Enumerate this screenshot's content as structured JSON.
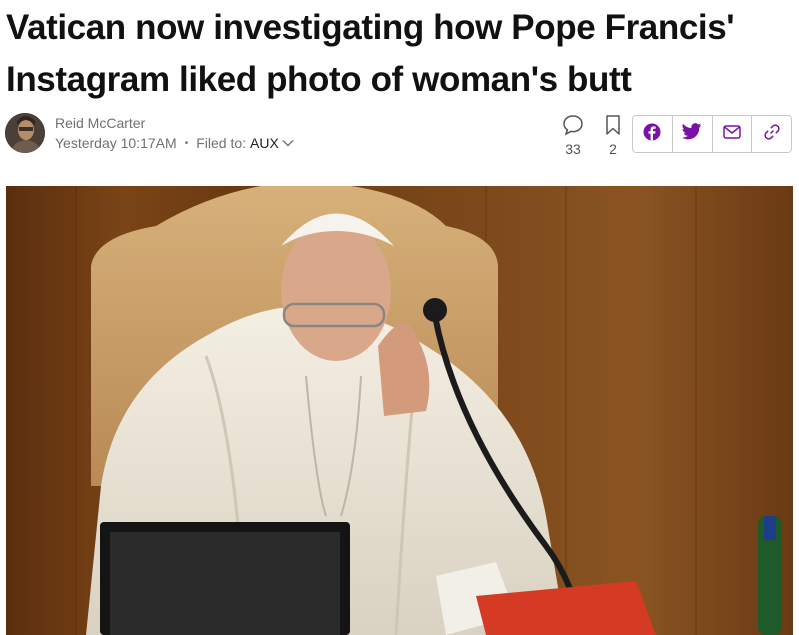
{
  "article": {
    "headline": "Vatican now investigating how Pope Francis' Instagram liked photo of woman's butt"
  },
  "byline": {
    "author": "Reid McCarter",
    "timestamp": "Yesterday 10:17AM",
    "separator": "•",
    "filed_label": "Filed to:",
    "category": "AUX"
  },
  "engagement": {
    "comments_count": "33",
    "saves_count": "2"
  },
  "share": {
    "icons": [
      "facebook-icon",
      "twitter-icon",
      "email-icon",
      "link-icon"
    ]
  },
  "hero_image": {
    "subject": "photo of Pope Francis seated at a desk with a microphone and monitor"
  },
  "colors": {
    "accent": "#7a12a8",
    "headline": "#111111",
    "meta": "#707070"
  }
}
